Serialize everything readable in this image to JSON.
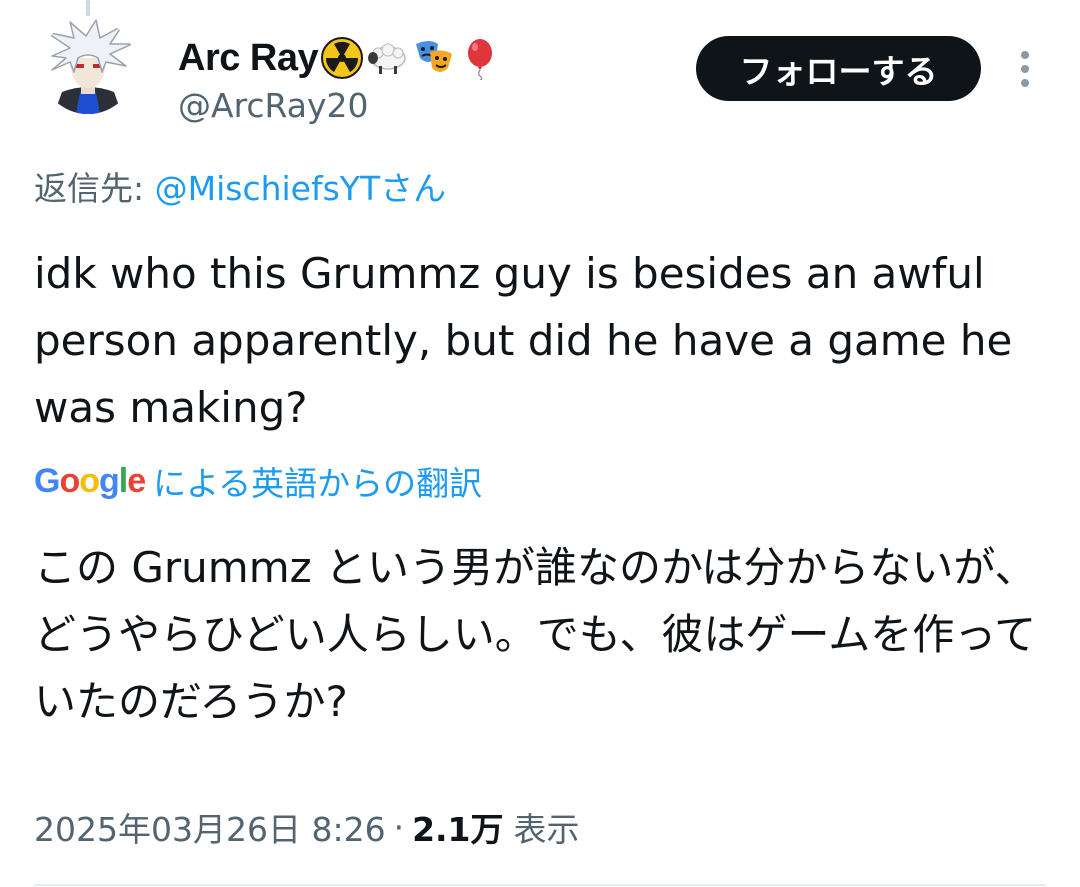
{
  "tweet": {
    "author": {
      "display_name": "Arc Ray",
      "name_emojis": [
        "radioactive-emoji",
        "sheep-emoji",
        "performing-arts-emoji",
        "balloon-emoji"
      ],
      "handle": "@ArcRay20",
      "avatar": "avatar"
    },
    "follow_label": "フォローする",
    "more_icon": "more-vertical-icon",
    "reply": {
      "prefix": "返信先: ",
      "mention": "@MischiefsYT",
      "suffix": "さん"
    },
    "text": "idk who this Grummz guy is besides an awful person apparently, but did he have a game he was making?",
    "translation": {
      "logo": {
        "letters": [
          "G",
          "o",
          "o",
          "g",
          "l",
          "e"
        ],
        "colors": [
          "#4285f4",
          "#ea4335",
          "#fbbc05",
          "#4285f4",
          "#34a853",
          "#ea4335"
        ]
      },
      "label": "による英語からの翻訳",
      "text": "この Grummz という男が誰なのかは分からないが、どうやらひどい人らしい。でも、彼はゲームを作っていたのだろうか?"
    },
    "meta": {
      "timestamp": "2025年03月26日 8:26",
      "separator": "·",
      "views_count": "2.1万",
      "views_label": "表示"
    }
  },
  "colors": {
    "text_primary": "#0f1419",
    "text_secondary": "#536471",
    "link": "#1d9bf0",
    "button_bg": "#0f1419",
    "button_text": "#ffffff",
    "divider": "#e6ecf0"
  }
}
